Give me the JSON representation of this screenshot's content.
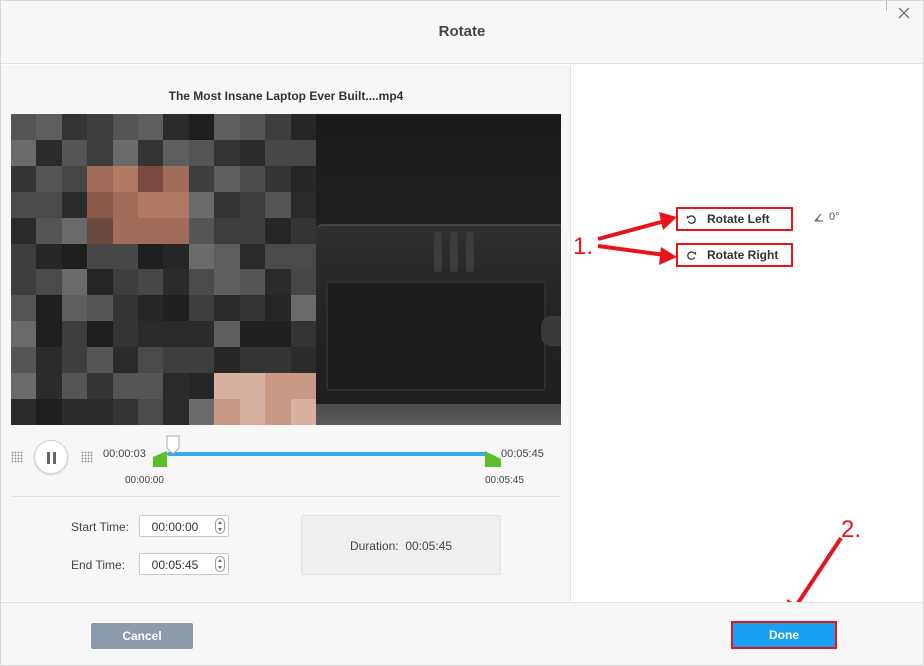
{
  "dialog": {
    "title": "Rotate",
    "close_icon": "close-icon"
  },
  "video": {
    "file_name": "The Most Insane Laptop Ever Built....mp4"
  },
  "playback": {
    "current_time": "00:00:03",
    "end_time": "00:05:45",
    "range_start": "00:00:00",
    "range_end": "00:05:45",
    "play_state_icon": "pause-icon",
    "progress_fraction": 0.01
  },
  "trim": {
    "start_label": "Start Time:",
    "start_value": "00:00:00",
    "end_label": "End Time:",
    "end_value": "00:05:45",
    "duration_label": "Duration:",
    "duration_value": "00:05:45"
  },
  "rotate": {
    "left_label": "Rotate Left",
    "right_label": "Rotate Right",
    "angle": "0°"
  },
  "annotations": {
    "step1": "1.",
    "step2": "2."
  },
  "footer": {
    "cancel_label": "Cancel",
    "done_label": "Done"
  },
  "colors": {
    "accent": "#1aa0f2",
    "annotation_red": "#e8141b",
    "track_blue": "#37a9ef",
    "handle_green": "#5cbf2a",
    "cancel_gray": "#8c9aab"
  }
}
